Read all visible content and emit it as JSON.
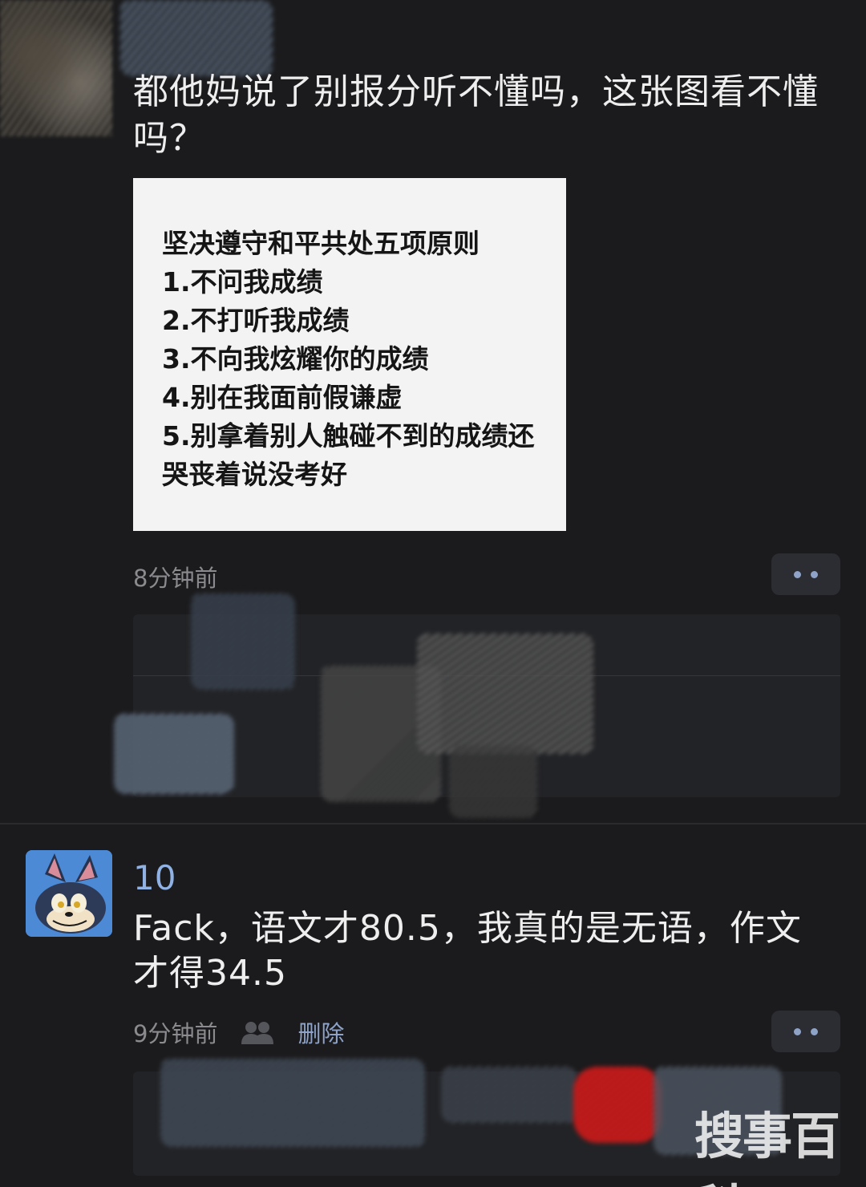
{
  "post": {
    "text": "都他妈说了别报分听不懂吗，这张图看不懂吗？",
    "image_lines": [
      "坚决遵守和平共处五项原则",
      "1.不问我成绩",
      "2.不打听我成绩",
      "3.不向我炫耀你的成绩",
      "4.别在我面前假谦虚",
      "5.别拿着别人触碰不到的成绩还哭丧着说没考好"
    ],
    "time": "8分钟前"
  },
  "comment": {
    "username": "10",
    "text": "Fack，语文才80.5，我真的是无语，作文才得34.5",
    "time": "9分钟前",
    "delete_label": "删除"
  },
  "icons": {
    "more": "more-dots-icon",
    "people": "people-icon"
  },
  "watermark": "搜事百科",
  "colors": {
    "background": "#1b1b1d",
    "accent": "#8ea3c7",
    "username": "#8fb1e4"
  }
}
